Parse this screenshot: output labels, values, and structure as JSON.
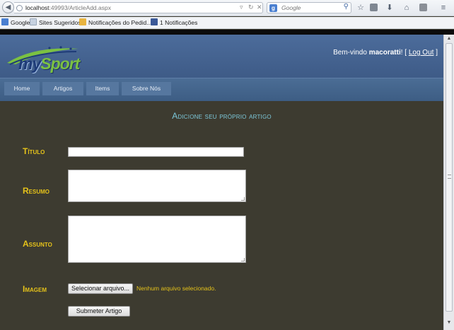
{
  "browser": {
    "url_host": "localhost",
    "url_rest": ":49993/ArticleAdd.aspx",
    "search_placeholder": "Google",
    "search_engine_letter": "g",
    "bookmarks": [
      {
        "label": "Google",
        "icon": "google-icon",
        "color": "#4a7fd0"
      },
      {
        "label": "Sites Sugeridos",
        "icon": "page-icon",
        "color": "#c7d2e0"
      },
      {
        "label": "Notificações do Pedid...",
        "icon": "folder-icon",
        "color": "#e8b440"
      },
      {
        "label": "1 Notificações",
        "icon": "facebook-icon",
        "color": "#3b5998"
      }
    ]
  },
  "header": {
    "brand_my": "my",
    "brand_sport": "Sport",
    "welcome_prefix": "Bem-vindo ",
    "username": "macoratti",
    "bracket_open": "! [ ",
    "logout": "Log Out",
    "bracket_close": " ]"
  },
  "menu": {
    "items": [
      "Home",
      "Artigos",
      "Items",
      "Sobre Nós"
    ]
  },
  "form": {
    "title": "Adicione seu próprio artigo",
    "fields": {
      "titulo": {
        "label": "Título",
        "value": ""
      },
      "resumo": {
        "label": "Resumo",
        "value": ""
      },
      "assunto": {
        "label": "Assunto",
        "value": ""
      },
      "imagem": {
        "label": "Imagem",
        "button": "Selecionar arquivo...",
        "status": "Nenhum arquivo selecionado."
      }
    },
    "submit": "Submeter Artigo"
  },
  "colors": {
    "content_bg": "#3d3b30",
    "header_blue": "#4c6c9b",
    "label_gold": "#e5c21a",
    "title_cyan": "#7cc7d9"
  }
}
